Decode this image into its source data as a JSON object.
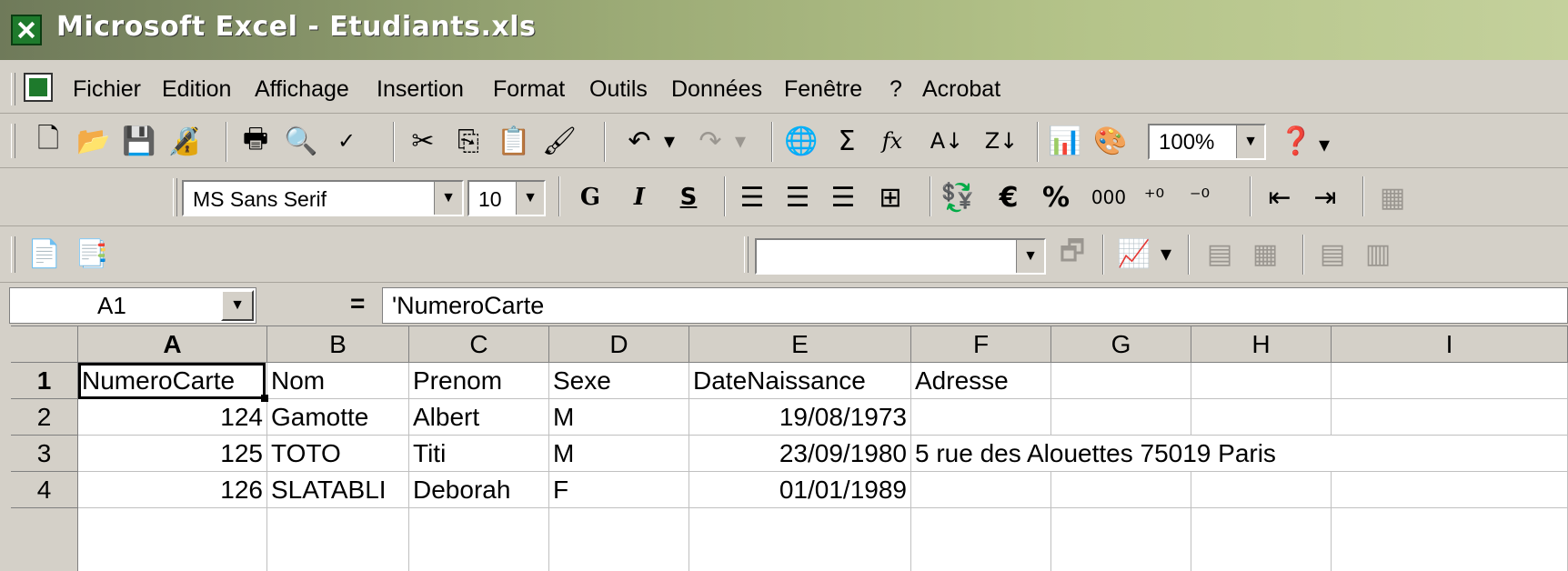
{
  "window": {
    "title": "Microsoft Excel - Etudiants.xls"
  },
  "menu": [
    "Fichier",
    "Edition",
    "Affichage",
    "Insertion",
    "Format",
    "Outils",
    "Données",
    "Fenêtre",
    "?",
    "Acrobat"
  ],
  "toolbar": {
    "zoom": "100%",
    "font_name": "MS Sans Serif",
    "font_size": "10",
    "bold_label": "G",
    "italic_label": "I",
    "underline_label": "S",
    "thousands_label": "000"
  },
  "formula": {
    "name_box": "A1",
    "equals": "=",
    "content": "'NumeroCarte"
  },
  "columns": [
    "A",
    "B",
    "C",
    "D",
    "E",
    "F",
    "G",
    "H",
    "I"
  ],
  "rows": [
    "1",
    "2",
    "3",
    "4"
  ],
  "cells": [
    [
      "NumeroCarte",
      "Nom",
      "Prenom",
      "Sexe",
      "DateNaissance",
      "Adresse"
    ],
    [
      "124",
      "Gamotte",
      "Albert",
      "M",
      "19/08/1973",
      ""
    ],
    [
      "125",
      "TOTO",
      "Titi",
      "M",
      "23/09/1980",
      "5 rue des Alouettes 75019 Paris"
    ],
    [
      "126",
      "SLATABLI",
      "Deborah",
      "F",
      "01/01/1989",
      ""
    ]
  ]
}
